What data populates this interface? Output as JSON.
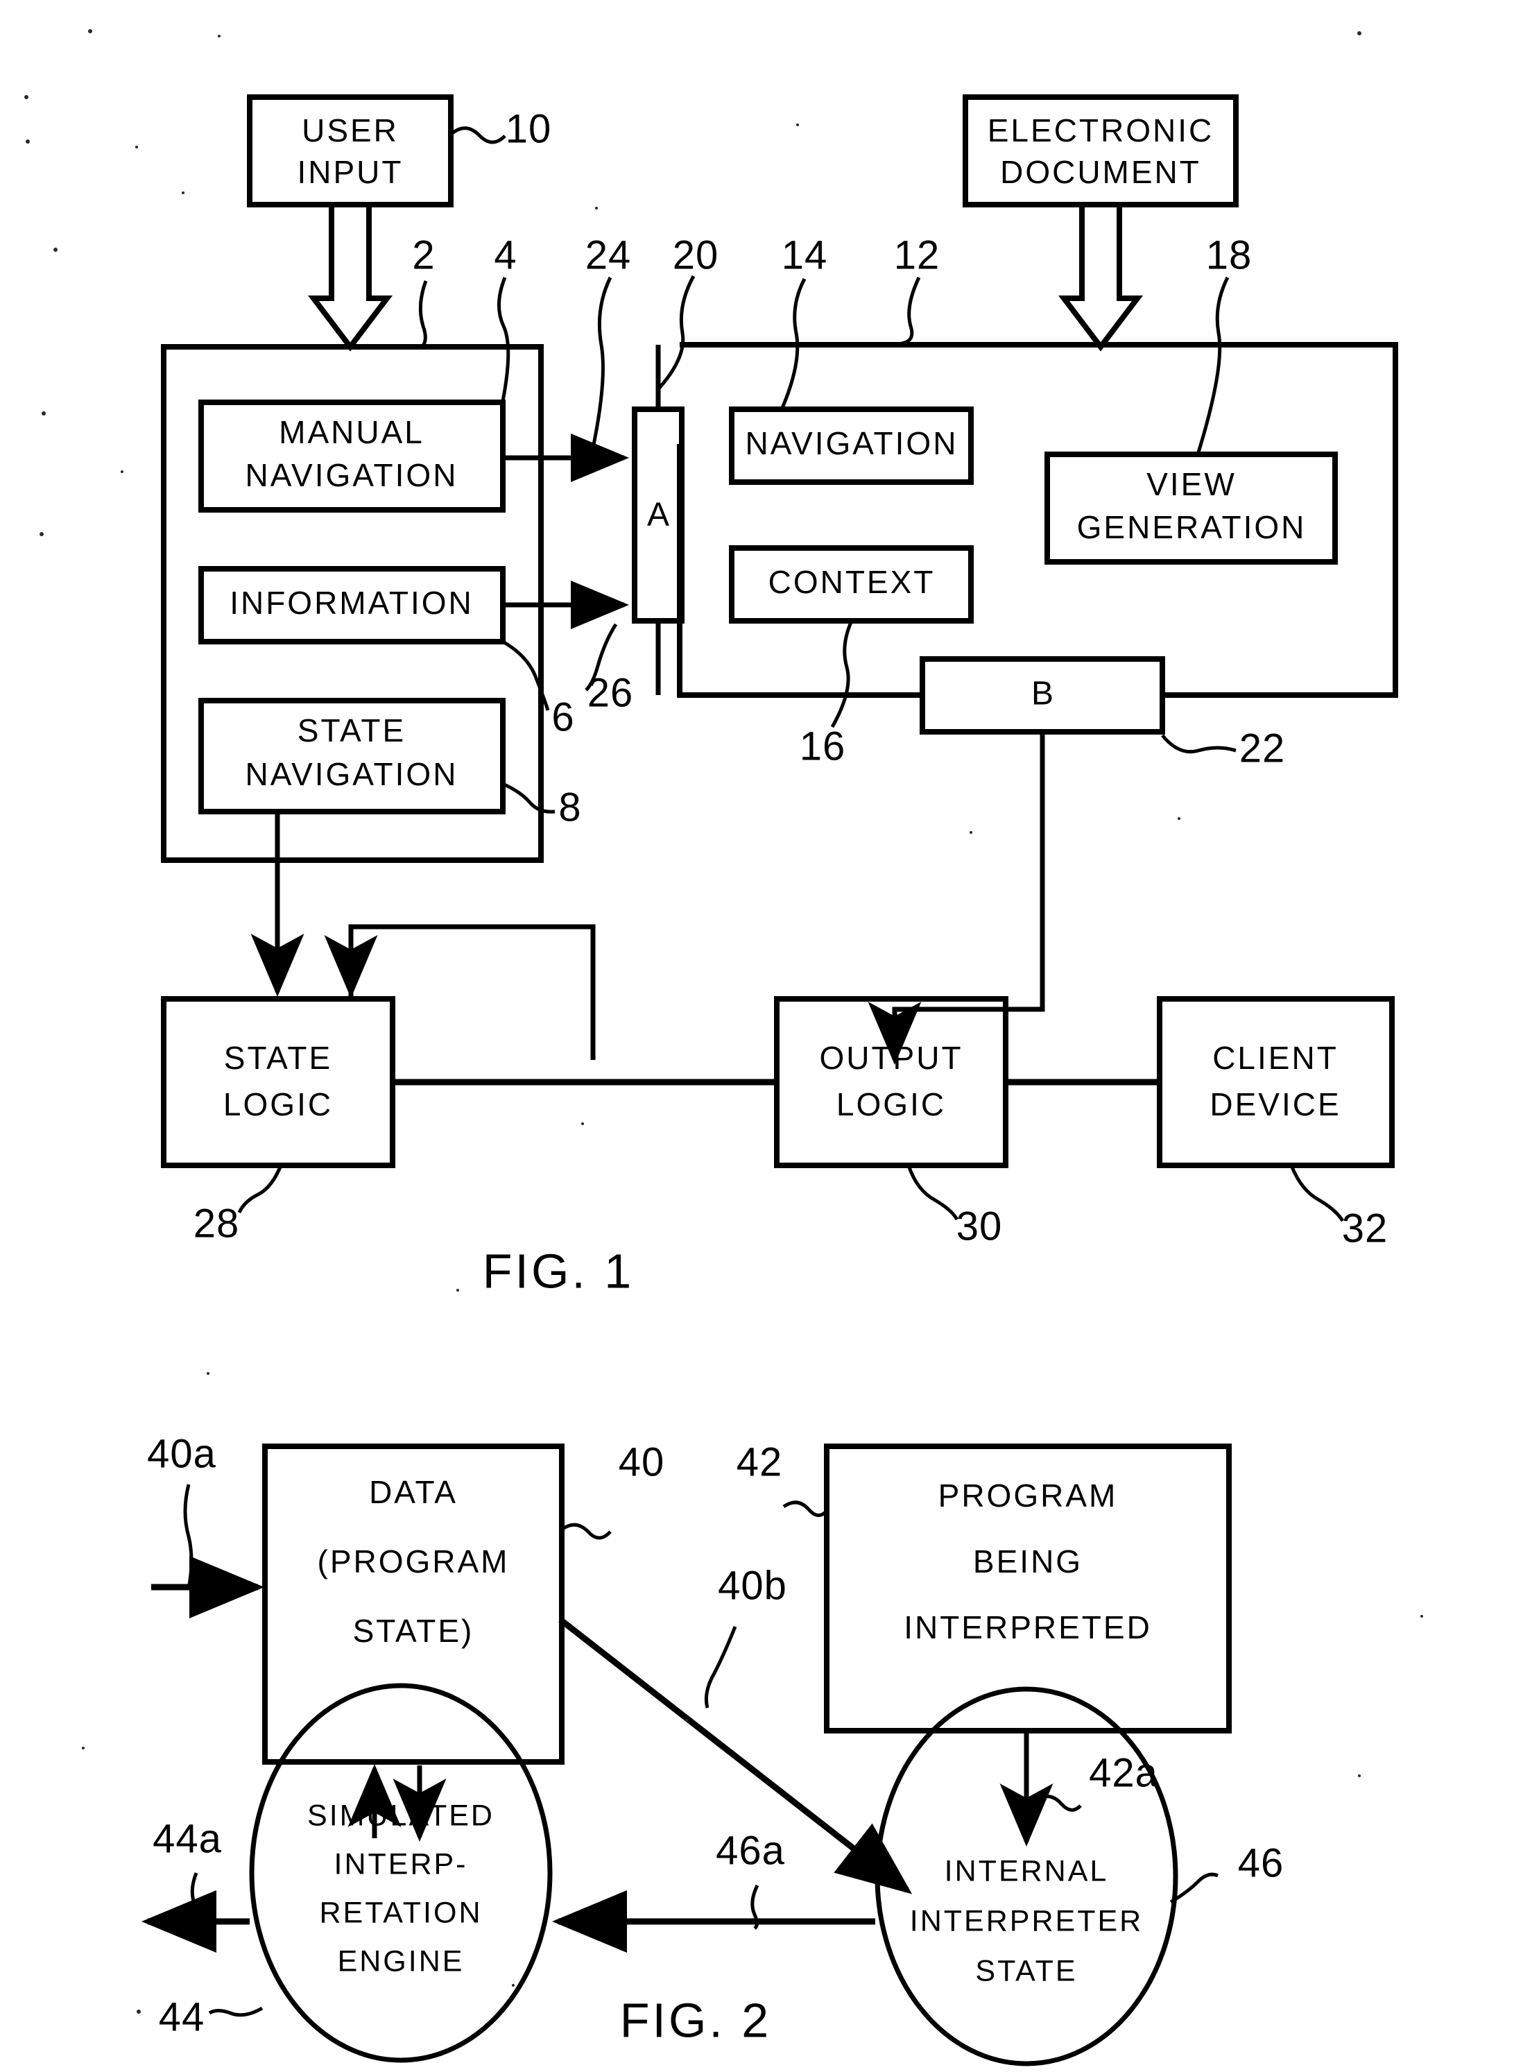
{
  "figure1": {
    "caption": "FIG. 1",
    "blocks": {
      "user_input": "USER\nINPUT",
      "user_input_l1": "USER",
      "user_input_l2": "INPUT",
      "electronic_document_l1": "ELECTRONIC",
      "electronic_document_l2": "DOCUMENT",
      "manual_navigation_l1": "MANUAL",
      "manual_navigation_l2": "NAVIGATION",
      "information": "INFORMATION",
      "state_navigation_l1": "STATE",
      "state_navigation_l2": "NAVIGATION",
      "navigation": "NAVIGATION",
      "context": "CONTEXT",
      "view_generation_l1": "VIEW",
      "view_generation_l2": "GENERATION",
      "connector_a": "A",
      "connector_b": "B",
      "state_logic_l1": "STATE",
      "state_logic_l2": "LOGIC",
      "output_logic_l1": "OUTPUT",
      "output_logic_l2": "LOGIC",
      "client_device_l1": "CLIENT",
      "client_device_l2": "DEVICE"
    },
    "reference_numerals": {
      "user_input": "10",
      "left_container": "2",
      "manual_navigation": "4",
      "bus_24": "24",
      "connector_a": "20",
      "navigation": "14",
      "right_container": "12",
      "view_generation": "18",
      "information": "6",
      "bus_26": "26",
      "state_navigation": "8",
      "context": "16",
      "connector_b": "22",
      "state_logic": "28",
      "output_logic": "30",
      "client_device": "32"
    }
  },
  "figure2": {
    "caption": "FIG. 2",
    "blocks": {
      "data_program_state_l1": "DATA",
      "data_program_state_l2": "(PROGRAM",
      "data_program_state_l3": "STATE)",
      "program_being_interpreted_l1": "PROGRAM",
      "program_being_interpreted_l2": "BEING",
      "program_being_interpreted_l3": "INTERPRETED",
      "simulated_engine_l1": "SIMULATED",
      "simulated_engine_l2": "INTERP-",
      "simulated_engine_l3": "RETATION",
      "simulated_engine_l4": "ENGINE",
      "internal_state_l1": "INTERNAL",
      "internal_state_l2": "INTERPRETER",
      "internal_state_l3": "STATE"
    },
    "reference_numerals": {
      "data_input_arrow": "40a",
      "data_block": "40",
      "data_to_engine_arrow": "40b",
      "program_block": "42",
      "program_to_state_arrow": "42a",
      "engine_output_arrow": "44a",
      "engine_block": "44",
      "state_to_engine_arrow": "46a",
      "state_block": "46"
    }
  },
  "colors": {
    "ink": "#000000",
    "paper": "#ffffff"
  }
}
